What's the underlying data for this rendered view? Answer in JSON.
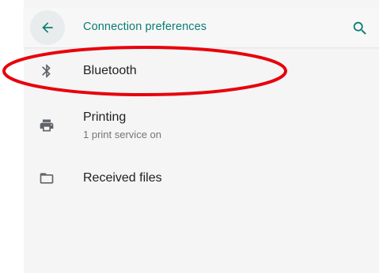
{
  "header": {
    "title": "Connection preferences",
    "back_icon": "arrow-back-icon",
    "search_icon": "search-icon"
  },
  "items": [
    {
      "label": "Bluetooth",
      "summary": "",
      "icon": "bluetooth-icon"
    },
    {
      "label": "Printing",
      "summary": "1 print service on",
      "icon": "printer-icon"
    },
    {
      "label": "Received files",
      "summary": "",
      "icon": "folder-icon"
    }
  ],
  "colors": {
    "accent": "#0a7d72",
    "highlight_ring": "#e8000b",
    "text_primary": "#202124",
    "text_secondary": "#757575"
  }
}
